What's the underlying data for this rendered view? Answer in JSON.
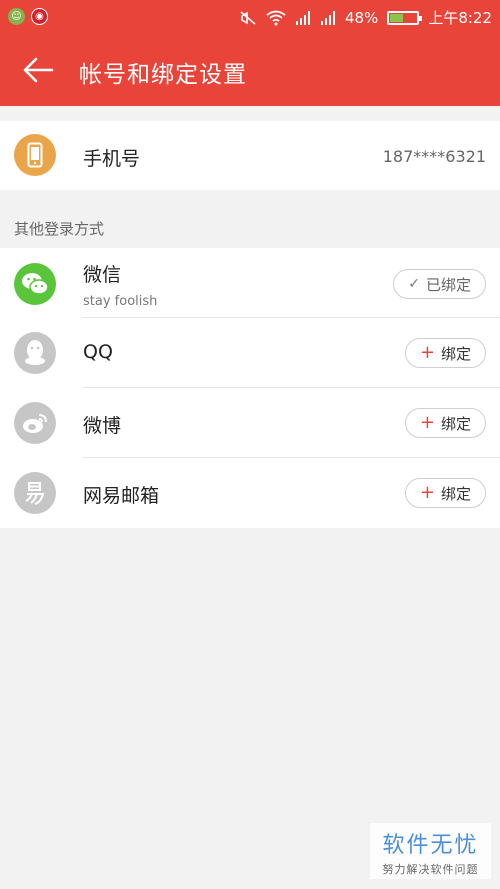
{
  "status_bar": {
    "battery_percent": "48%",
    "battery_level": 0.48,
    "time": "上午8:22"
  },
  "app_bar": {
    "title": "帐号和绑定设置"
  },
  "phone": {
    "label": "手机号",
    "value": "187****6321"
  },
  "other_login": {
    "section_title": "其他登录方式",
    "items": [
      {
        "name": "微信",
        "subtitle": "stay foolish",
        "status": "已绑定",
        "bound": true,
        "icon": "wechat-icon",
        "color": "#5ac43a"
      },
      {
        "name": "QQ",
        "status": "绑定",
        "bound": false,
        "icon": "qq-icon",
        "color": "#c6c6c6"
      },
      {
        "name": "微博",
        "status": "绑定",
        "bound": false,
        "icon": "weibo-icon",
        "color": "#c6c6c6"
      },
      {
        "name": "网易邮箱",
        "status": "绑定",
        "bound": false,
        "icon": "netease-mail-icon",
        "color": "#c6c6c6"
      }
    ]
  },
  "colors": {
    "brand": "#e8443a",
    "phone_icon": "#eaa54a"
  },
  "watermark": {
    "big": "软件无忧",
    "small": "努力解决软件问题"
  }
}
